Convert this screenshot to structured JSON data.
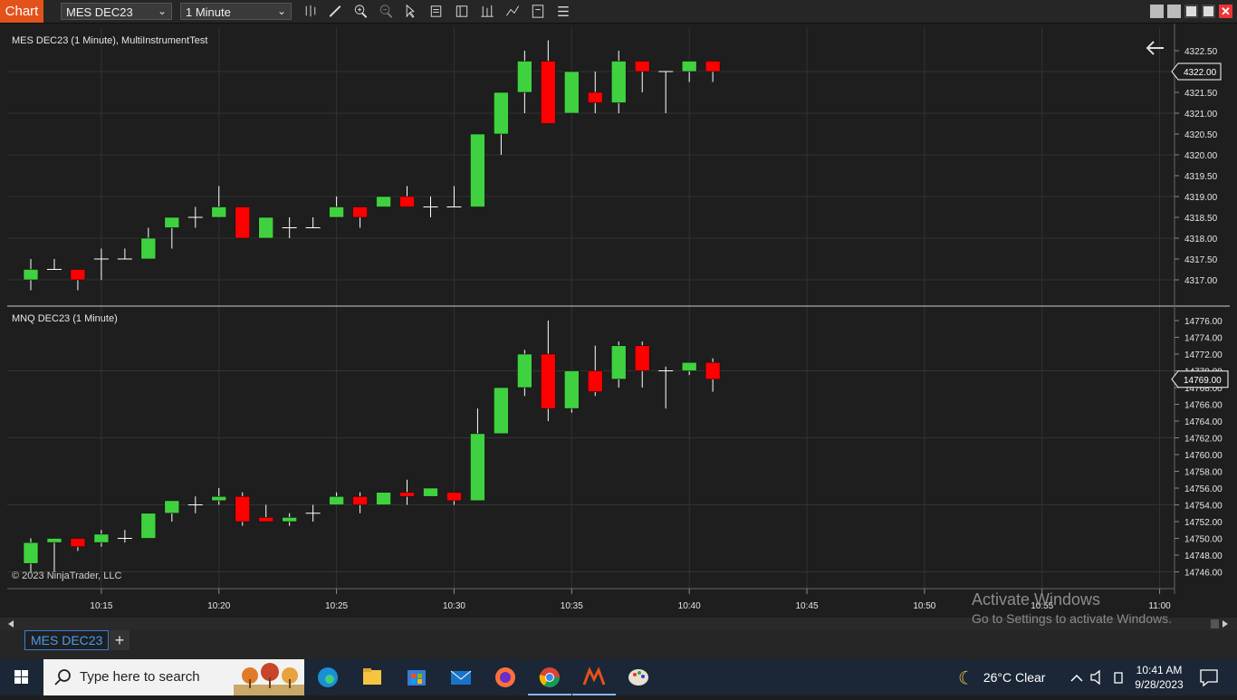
{
  "toolbar": {
    "chart_label": "Chart",
    "instrument": "MES DEC23",
    "interval": "1 Minute",
    "icons": [
      "bars-type-icon",
      "drawing-pencil-icon",
      "zoom-in-icon",
      "zoom-out-icon",
      "pointer-icon",
      "data-box-icon",
      "properties-icon",
      "indicators-icon",
      "strategies-icon",
      "templates-icon",
      "menu-icon"
    ],
    "window_buttons": [
      "tile-icon",
      "tile-icon",
      "minimize-icon",
      "restore-icon",
      "close-icon"
    ]
  },
  "panel_top": {
    "label": "MES DEC23 (1 Minute), MultiInstrumentTest",
    "price_ticks": [
      "4322.50",
      "4321.50",
      "4321.00",
      "4320.50",
      "4320.00",
      "4319.50",
      "4319.00",
      "4318.50",
      "4318.00",
      "4317.50",
      "4317.00"
    ],
    "current_price": "4322.00",
    "back_icon": "arrow-left-icon"
  },
  "panel_bottom": {
    "label": "MNQ DEC23 (1 Minute)",
    "price_ticks": [
      "14776.00",
      "14774.00",
      "14772.00",
      "14770.00",
      "14768.00",
      "14766.00",
      "14764.00",
      "14762.00",
      "14760.00",
      "14758.00",
      "14756.00",
      "14754.00",
      "14752.00",
      "14750.00",
      "14748.00",
      "14746.00"
    ],
    "current_price": "14769.00",
    "copyright": "© 2023 NinjaTrader, LLC"
  },
  "time_axis": [
    "10:15",
    "10:20",
    "10:25",
    "10:30",
    "10:35",
    "10:40",
    "10:45",
    "10:50",
    "10:55",
    "11:00"
  ],
  "tabs": {
    "active": "MES DEC23",
    "add_label": "+"
  },
  "activation": {
    "line1": "Activate Windows",
    "line2": "Go to Settings to activate Windows."
  },
  "taskbar": {
    "search_placeholder": "Type here to search",
    "apps": [
      "edge-icon",
      "file-explorer-icon",
      "store-icon",
      "mail-icon",
      "firefox-icon",
      "chrome-icon",
      "ninjatrader-icon",
      "paint-icon"
    ],
    "weather": "26°C  Clear",
    "time": "10:41 AM",
    "date": "9/28/2023"
  },
  "chart_data": [
    {
      "type": "candlestick",
      "title": "MES DEC23 (1 Minute), MultiInstrumentTest",
      "x": [
        "10:12",
        "10:13",
        "10:14",
        "10:15",
        "10:16",
        "10:17",
        "10:18",
        "10:19",
        "10:20",
        "10:21",
        "10:22",
        "10:23",
        "10:24",
        "10:25",
        "10:26",
        "10:27",
        "10:28",
        "10:29",
        "10:30",
        "10:31",
        "10:32",
        "10:33",
        "10:34",
        "10:35",
        "10:36",
        "10:37",
        "10:38",
        "10:39",
        "10:40",
        "10:41"
      ],
      "ohlc": [
        [
          4317.0,
          4317.5,
          4316.75,
          4317.25
        ],
        [
          4317.25,
          4317.5,
          4317.25,
          4317.25
        ],
        [
          4317.25,
          4317.25,
          4316.75,
          4317.0
        ],
        [
          4317.5,
          4317.75,
          4317.0,
          4317.5
        ],
        [
          4317.5,
          4317.75,
          4317.5,
          4317.5
        ],
        [
          4317.5,
          4318.25,
          4317.5,
          4318.0
        ],
        [
          4318.25,
          4318.5,
          4317.75,
          4318.5
        ],
        [
          4318.5,
          4318.75,
          4318.25,
          4318.5
        ],
        [
          4318.5,
          4319.25,
          4318.5,
          4318.75
        ],
        [
          4318.75,
          4318.75,
          4318.0,
          4318.0
        ],
        [
          4318.0,
          4318.5,
          4318.0,
          4318.5
        ],
        [
          4318.25,
          4318.5,
          4318.0,
          4318.25
        ],
        [
          4318.25,
          4318.5,
          4318.25,
          4318.25
        ],
        [
          4318.5,
          4319.0,
          4318.5,
          4318.75
        ],
        [
          4318.75,
          4318.75,
          4318.25,
          4318.5
        ],
        [
          4318.75,
          4319.0,
          4318.75,
          4319.0
        ],
        [
          4319.0,
          4319.25,
          4318.75,
          4318.75
        ],
        [
          4318.75,
          4319.0,
          4318.5,
          4318.75
        ],
        [
          4318.75,
          4319.25,
          4318.75,
          4318.75
        ],
        [
          4318.75,
          4320.5,
          4318.75,
          4320.5
        ],
        [
          4320.5,
          4321.5,
          4320.0,
          4321.5
        ],
        [
          4321.5,
          4322.5,
          4321.0,
          4322.25
        ],
        [
          4322.25,
          4322.75,
          4320.75,
          4320.75
        ],
        [
          4321.0,
          4322.0,
          4321.0,
          4322.0
        ],
        [
          4321.5,
          4322.0,
          4321.0,
          4321.25
        ],
        [
          4321.25,
          4322.5,
          4321.0,
          4322.25
        ],
        [
          4322.25,
          4322.25,
          4321.5,
          4322.0
        ],
        [
          4322.0,
          4322.0,
          4321.0,
          4322.0
        ],
        [
          4322.0,
          4322.25,
          4321.75,
          4322.25
        ],
        [
          4322.25,
          4322.25,
          4321.75,
          4322.0
        ]
      ],
      "ylim": [
        4316.5,
        4323.0
      ]
    },
    {
      "type": "candlestick",
      "title": "MNQ DEC23 (1 Minute)",
      "x": [
        "10:12",
        "10:13",
        "10:14",
        "10:15",
        "10:16",
        "10:17",
        "10:18",
        "10:19",
        "10:20",
        "10:21",
        "10:22",
        "10:23",
        "10:24",
        "10:25",
        "10:26",
        "10:27",
        "10:28",
        "10:29",
        "10:30",
        "10:31",
        "10:32",
        "10:33",
        "10:34",
        "10:35",
        "10:36",
        "10:37",
        "10:38",
        "10:39",
        "10:40",
        "10:41"
      ],
      "ohlc": [
        [
          14747.0,
          14750.0,
          14746.0,
          14749.5
        ],
        [
          14749.5,
          14750.0,
          14746.0,
          14750.0
        ],
        [
          14750.0,
          14750.0,
          14748.5,
          14749.0
        ],
        [
          14749.5,
          14751.0,
          14749.0,
          14750.5
        ],
        [
          14750.0,
          14751.0,
          14749.5,
          14750.0
        ],
        [
          14750.0,
          14753.0,
          14750.0,
          14753.0
        ],
        [
          14753.0,
          14754.5,
          14752.0,
          14754.5
        ],
        [
          14754.0,
          14755.0,
          14753.0,
          14754.0
        ],
        [
          14754.5,
          14756.0,
          14754.0,
          14755.0
        ],
        [
          14755.0,
          14755.5,
          14751.5,
          14752.0
        ],
        [
          14752.5,
          14754.0,
          14752.0,
          14752.0
        ],
        [
          14752.0,
          14753.0,
          14751.5,
          14752.5
        ],
        [
          14753.0,
          14754.0,
          14752.0,
          14753.0
        ],
        [
          14754.0,
          14755.5,
          14754.0,
          14755.0
        ],
        [
          14755.0,
          14755.5,
          14753.0,
          14754.0
        ],
        [
          14754.0,
          14755.5,
          14754.0,
          14755.5
        ],
        [
          14755.5,
          14757.0,
          14754.0,
          14755.0
        ],
        [
          14755.0,
          14756.0,
          14755.0,
          14756.0
        ],
        [
          14755.5,
          14755.5,
          14754.0,
          14754.5
        ],
        [
          14754.5,
          14765.5,
          14754.5,
          14762.5
        ],
        [
          14762.5,
          14768.0,
          14762.5,
          14768.0
        ],
        [
          14768.0,
          14772.5,
          14767.0,
          14772.0
        ],
        [
          14772.0,
          14776.0,
          14764.0,
          14765.5
        ],
        [
          14765.5,
          14770.0,
          14765.0,
          14770.0
        ],
        [
          14770.0,
          14773.0,
          14767.0,
          14767.5
        ],
        [
          14769.0,
          14773.5,
          14768.0,
          14773.0
        ],
        [
          14773.0,
          14773.5,
          14768.0,
          14770.0
        ],
        [
          14770.0,
          14770.5,
          14765.5,
          14770.0
        ],
        [
          14770.0,
          14771.0,
          14769.5,
          14771.0
        ],
        [
          14771.0,
          14771.5,
          14767.5,
          14769.0
        ]
      ],
      "ylim": [
        14745.0,
        14777.0
      ]
    }
  ],
  "colors": {
    "up": "#3fd13f",
    "down": "#ff0000",
    "background": "#1e1e1e",
    "grid": "#333333",
    "accent": "#e4521b"
  }
}
